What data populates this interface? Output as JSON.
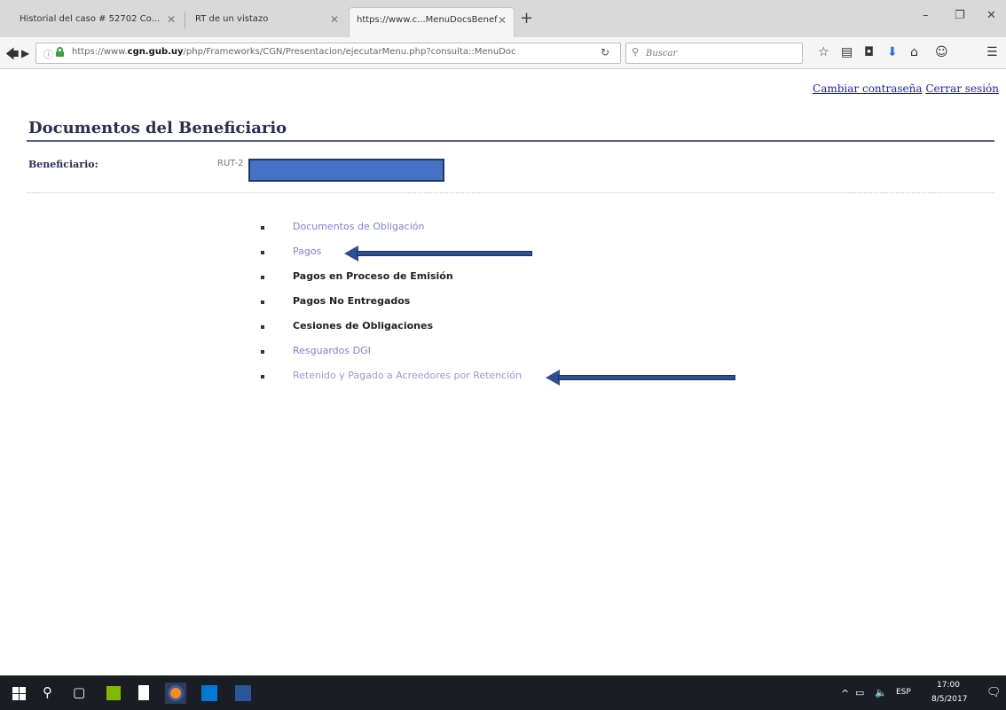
{
  "browser": {
    "tabs": [
      {
        "label": "Historial del caso # 52702 Co...",
        "active": false
      },
      {
        "label": "RT de un vistazo",
        "active": false
      },
      {
        "label": "https://www.c...MenuDocsBenef",
        "active": true
      }
    ],
    "new_tab_symbol": "+",
    "url_plain_prefix": "https://www.",
    "url_domain": "cgn.gub.uy",
    "url_rest": "/php/Frameworks/CGN/Presentacion/ejecutarMenu.php?consulta::MenuDoc",
    "search_placeholder": "Buscar"
  },
  "page": {
    "links": {
      "change_password": "Cambiar contraseña",
      "logout": "Cerrar sesión"
    },
    "title": "Documentos del Beneficiario",
    "beneficiary_label": "Beneficiario:",
    "beneficiary_value": "RUT-2",
    "menu_items": [
      {
        "label": "Documentos de Obligación",
        "style": "link"
      },
      {
        "label": "Pagos",
        "style": "link"
      },
      {
        "label": "Pagos en Proceso de Emisión",
        "style": "plain"
      },
      {
        "label": "Pagos No Entregados",
        "style": "plain"
      },
      {
        "label": "Cesiones de Obligaciones",
        "style": "plain"
      },
      {
        "label": "Resguardos DGI",
        "style": "link"
      },
      {
        "label": "Retenido y Pagado a Acreedores por Retención",
        "style": "faded"
      }
    ]
  },
  "taskbar": {
    "language": "ESP",
    "time": "17:00",
    "date": "8/5/2017"
  },
  "colors": {
    "title": "#2b2f55",
    "link": "#1b1bd0",
    "menu_link": "#8080d8",
    "annotation_arrow": "#2e4f8f",
    "redaction": "#4472c4"
  }
}
